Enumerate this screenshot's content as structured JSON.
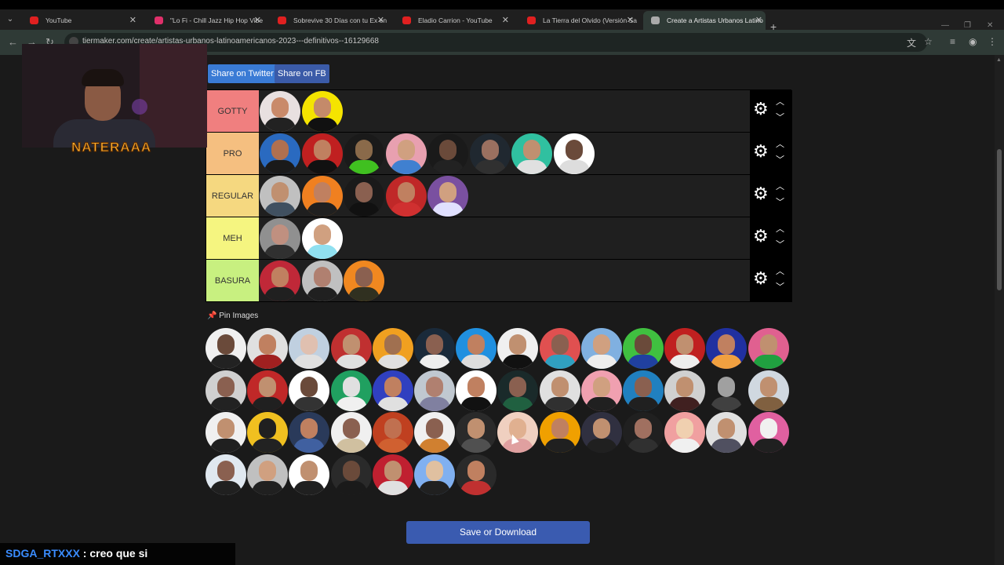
{
  "browser": {
    "tabs": [
      {
        "title": "YouTube",
        "favicon_color": "#e02020",
        "active": false
      },
      {
        "title": "\"Lo Fi - Chill Jazz Hip Hop Vibe",
        "favicon_color": "#e0306a",
        "active": false
      },
      {
        "title": "Sobrevive 30 Días con tu Ex en l",
        "favicon_color": "#e02020",
        "active": false
      },
      {
        "title": "Eladio Carrion - YouTube",
        "favicon_color": "#e02020",
        "active": false
      },
      {
        "title": "La Tierra del Olvido (Versión Sa",
        "favicon_color": "#e02020",
        "active": false
      },
      {
        "title": "Create a Artistas Urbanos Latino",
        "favicon_color": "#aaaaaa",
        "active": true
      }
    ],
    "url": "tiermaker.com/create/artistas-urbanos-latinoamericanos-2023---definitivos--16129668"
  },
  "share": {
    "twitter_label": "Share on Twitter",
    "fb_label": "Share on FB",
    "twitter_color": "#3a7bd5",
    "fb_color": "#3b5ba8"
  },
  "tiers": [
    {
      "label": "GOTTY",
      "color": "#f07f7f",
      "items": [
        {
          "bg": "#e8e0e0",
          "skin": "#c98a6a",
          "cloth": "#222"
        },
        {
          "bg": "#f5e400",
          "skin": "#c48a6a",
          "cloth": "#111"
        }
      ]
    },
    {
      "label": "PRO",
      "color": "#f5bf80",
      "items": [
        {
          "bg": "#2a6ac0",
          "skin": "#b07050",
          "cloth": "#1a1a1a"
        },
        {
          "bg": "#c02020",
          "skin": "#c08060",
          "cloth": "#111"
        },
        {
          "bg": "#1a1a1a",
          "skin": "#8a6a4a",
          "cloth": "#40c020"
        },
        {
          "bg": "#e8a0b0",
          "skin": "#d0a080",
          "cloth": "#4080d0"
        },
        {
          "bg": "#1a1a1a",
          "skin": "#6a4a3a",
          "cloth": "#222"
        },
        {
          "bg": "#202830",
          "skin": "#9a7060",
          "cloth": "#303030"
        },
        {
          "bg": "#30c0a0",
          "skin": "#c09070",
          "cloth": "#e0e0e0"
        },
        {
          "bg": "#ffffff",
          "skin": "#6a4a3a",
          "cloth": "#ddd"
        }
      ]
    },
    {
      "label": "REGULAR",
      "color": "#f5d880",
      "items": [
        {
          "bg": "#c0c0c0",
          "skin": "#c09070",
          "cloth": "#405060"
        },
        {
          "bg": "#f08020",
          "skin": "#c08060",
          "cloth": "#202020"
        },
        {
          "bg": "#1a1a1a",
          "skin": "#8a6050",
          "cloth": "#111"
        },
        {
          "bg": "#c02828",
          "skin": "#c08060",
          "cloth": "#d03030"
        },
        {
          "bg": "#7a50a0",
          "skin": "#d0a080",
          "cloth": "#e0e0ff"
        }
      ]
    },
    {
      "label": "MEH",
      "color": "#f5f580",
      "items": [
        {
          "bg": "#909090",
          "skin": "#c09080",
          "cloth": "#303030"
        },
        {
          "bg": "#ffffff",
          "skin": "#d0a080",
          "cloth": "#90e0f0"
        }
      ]
    },
    {
      "label": "BASURA",
      "color": "#c8f080",
      "items": [
        {
          "bg": "#c02838",
          "skin": "#c08060",
          "cloth": "#202020"
        },
        {
          "bg": "#c0c0c0",
          "skin": "#b08070",
          "cloth": "#202020"
        },
        {
          "bg": "#f08820",
          "skin": "#8a6050",
          "cloth": "#303020"
        }
      ]
    }
  ],
  "pool": {
    "label": "Pin Images",
    "items": [
      {
        "bg": "#f0f0f0",
        "skin": "#6a4a3a",
        "cloth": "#222"
      },
      {
        "bg": "#e0e0e0",
        "skin": "#c08060",
        "cloth": "#a02020"
      },
      {
        "bg": "#c0d0e0",
        "skin": "#e0c0b0",
        "cloth": "#e0e0e0"
      },
      {
        "bg": "#c03030",
        "skin": "#c09070",
        "cloth": "#e0e0e0"
      },
      {
        "bg": "#f0a020",
        "skin": "#a07050",
        "cloth": "#e0e0e0"
      },
      {
        "bg": "#1a2a3a",
        "skin": "#8a6050",
        "cloth": "#eee"
      },
      {
        "bg": "#2090e0",
        "skin": "#c08060",
        "cloth": "#ddd"
      },
      {
        "bg": "#f0f0f0",
        "skin": "#c09070",
        "cloth": "#111"
      },
      {
        "bg": "#e05050",
        "skin": "#8a6050",
        "cloth": "#30a0c0"
      },
      {
        "bg": "#80b0e0",
        "skin": "#d0a080",
        "cloth": "#eee"
      },
      {
        "bg": "#40c040",
        "skin": "#6a4a3a",
        "cloth": "#2040a0"
      },
      {
        "bg": "#c02020",
        "skin": "#c09070",
        "cloth": "#eee"
      },
      {
        "bg": "#2030a0",
        "skin": "#c08060",
        "cloth": "#f0a040"
      },
      {
        "bg": "#e06090",
        "skin": "#c09070",
        "cloth": "#20a040"
      },
      {
        "bg": "#d0d0d0",
        "skin": "#8a6050",
        "cloth": "#222"
      },
      {
        "bg": "#c02828",
        "skin": "#c09070",
        "cloth": "#202020"
      },
      {
        "bg": "#ffffff",
        "skin": "#6a4a3a",
        "cloth": "#333"
      },
      {
        "bg": "#20a060",
        "skin": "#e0e0e0",
        "cloth": "#f0f0f0"
      },
      {
        "bg": "#3040c0",
        "skin": "#c08060",
        "cloth": "#e0e0e0"
      },
      {
        "bg": "#c0c8d0",
        "skin": "#b08070",
        "cloth": "#8080a0"
      },
      {
        "bg": "#ffffff",
        "skin": "#c08060",
        "cloth": "#111"
      },
      {
        "bg": "#1a2a2a",
        "skin": "#8a6050",
        "cloth": "#206040"
      },
      {
        "bg": "#e0e0e0",
        "skin": "#c09070",
        "cloth": "#303030"
      },
      {
        "bg": "#f0a0b0",
        "skin": "#d0a080",
        "cloth": "#202020"
      },
      {
        "bg": "#2080c0",
        "skin": "#8a6050",
        "cloth": "#202020"
      },
      {
        "bg": "#d0d0d0",
        "skin": "#c09070",
        "cloth": "#402020"
      },
      {
        "bg": "#1a1a1a",
        "skin": "#a0a0a0",
        "cloth": "#404040"
      },
      {
        "bg": "#d0d8e0",
        "skin": "#c09070",
        "cloth": "#806040"
      },
      {
        "bg": "#f0f0f0",
        "skin": "#c09070",
        "cloth": "#202020"
      },
      {
        "bg": "#f0c020",
        "skin": "#202020",
        "cloth": "#222"
      },
      {
        "bg": "#2a3a5a",
        "skin": "#c08060",
        "cloth": "#4060a0"
      },
      {
        "bg": "#f0f0f0",
        "skin": "#8a6050",
        "cloth": "#d0c0a0"
      },
      {
        "bg": "#c04020",
        "skin": "#c07050",
        "cloth": "#d06030"
      },
      {
        "bg": "#f0f0f0",
        "skin": "#8a6050",
        "cloth": "#d08030"
      },
      {
        "bg": "#2a2a2a",
        "skin": "#c09070",
        "cloth": "#505050"
      },
      {
        "bg": "#f0d0c0",
        "skin": "#e0b090",
        "cloth": "#e0a0a0"
      },
      {
        "bg": "#f0a000",
        "skin": "#c08060",
        "cloth": "#202020"
      },
      {
        "bg": "#303040",
        "skin": "#c09070",
        "cloth": "#202020"
      },
      {
        "bg": "#202020",
        "skin": "#a07060",
        "cloth": "#303030"
      },
      {
        "bg": "#f0a0a0",
        "skin": "#f0d0b0",
        "cloth": "#f0f0f0"
      },
      {
        "bg": "#e0e0e0",
        "skin": "#c09070",
        "cloth": "#505060"
      },
      {
        "bg": "#e060a0",
        "skin": "#f0f0f0",
        "cloth": "#202020"
      },
      {
        "bg": "#e0e8f0",
        "skin": "#8a6050",
        "cloth": "#202020"
      },
      {
        "bg": "#c0c0c0",
        "skin": "#d0a080",
        "cloth": "#202020"
      },
      {
        "bg": "#ffffff",
        "skin": "#c09070",
        "cloth": "#202020"
      },
      {
        "bg": "#2a2a2a",
        "skin": "#6a4a3a",
        "cloth": "#1a1a1a"
      },
      {
        "bg": "#c02030",
        "skin": "#c09070",
        "cloth": "#e0e0e0"
      },
      {
        "bg": "#80b0f0",
        "skin": "#e0c0a0",
        "cloth": "#202020"
      },
      {
        "bg": "#2a2a2a",
        "skin": "#c08060",
        "cloth": "#c03030"
      }
    ]
  },
  "save_label": "Save or Download",
  "webcam": {
    "name": "NATERAAA"
  },
  "chat": {
    "user": "SDGA_RTXXX",
    "message": " : creo que si"
  }
}
